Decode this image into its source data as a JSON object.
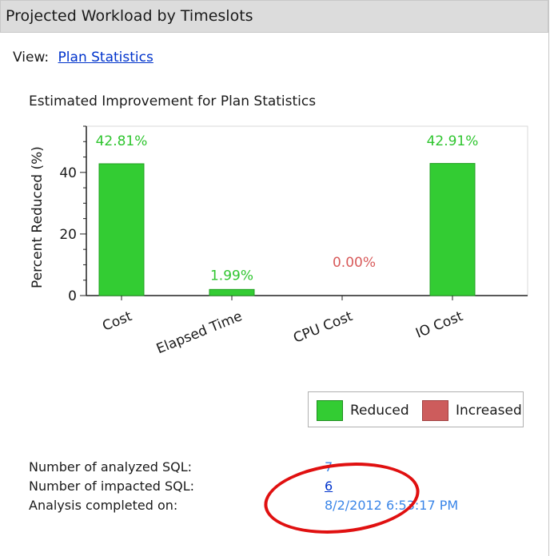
{
  "panel": {
    "title": "Projected Workload by Timeslots"
  },
  "view": {
    "label": "View:",
    "link": "Plan Statistics"
  },
  "chart_title": "Estimated Improvement for Plan Statistics",
  "chart_data": {
    "type": "bar",
    "categories": [
      "Cost",
      "Elapsed Time",
      "CPU Cost",
      "IO Cost"
    ],
    "values": [
      42.81,
      1.99,
      0.0,
      42.91
    ],
    "data_labels": [
      "42.81%",
      "1.99%",
      "0.00%",
      "42.91%"
    ],
    "label_colors": [
      "#2ec52e",
      "#2ec52e",
      "#d85a5a",
      "#2ec52e"
    ],
    "ylabel": "Percent Reduced (%)",
    "yticks": [
      0,
      20,
      40
    ],
    "ylim": [
      0,
      55
    ],
    "grid": false,
    "legend_position": "bottom-right",
    "legend": [
      {
        "name": "Reduced",
        "color": "#33cc33"
      },
      {
        "name": "Increased",
        "color": "#cd5c5c"
      }
    ]
  },
  "stats": [
    {
      "label": "Number of analyzed SQL:",
      "value": "7"
    },
    {
      "label": "Number of impacted SQL:",
      "value": "6"
    },
    {
      "label": "Analysis completed on:",
      "value": "8/2/2012 6:53:17 PM"
    }
  ],
  "colors": {
    "bar": "#33cc33",
    "highlight": "#e01010",
    "link": "#0033cc"
  }
}
